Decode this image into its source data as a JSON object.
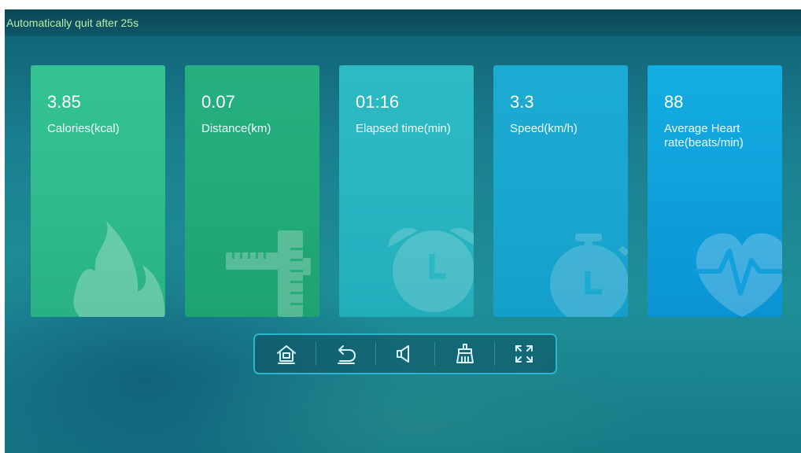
{
  "status_bar": {
    "text": "Automatically quit after 25s"
  },
  "cards": [
    {
      "value": "3.85",
      "label": "Calories(kcal)",
      "icon": "flame-icon",
      "color": "#2fbd8c"
    },
    {
      "value": "0.07",
      "label": "Distance(km)",
      "icon": "ruler-icon",
      "color": "#22ad7a"
    },
    {
      "value": "01:16",
      "label": "Elapsed time(min)",
      "icon": "alarm-clock-icon",
      "color": "#27b6c2"
    },
    {
      "value": "3.3",
      "label": "Speed(km/h)",
      "icon": "stopwatch-icon",
      "color": "#19a7cf"
    },
    {
      "value": "88",
      "label": "Average Heart rate(beats/min)",
      "icon": "heart-pulse-icon",
      "color": "#0c9bdd"
    }
  ],
  "nav": {
    "buttons": [
      {
        "name": "home",
        "icon": "home-icon"
      },
      {
        "name": "back",
        "icon": "back-icon"
      },
      {
        "name": "volume",
        "icon": "volume-icon"
      },
      {
        "name": "clean",
        "icon": "brush-icon"
      },
      {
        "name": "fullscreen",
        "icon": "fullscreen-icon"
      }
    ],
    "border_color": "#2ab6cf"
  }
}
